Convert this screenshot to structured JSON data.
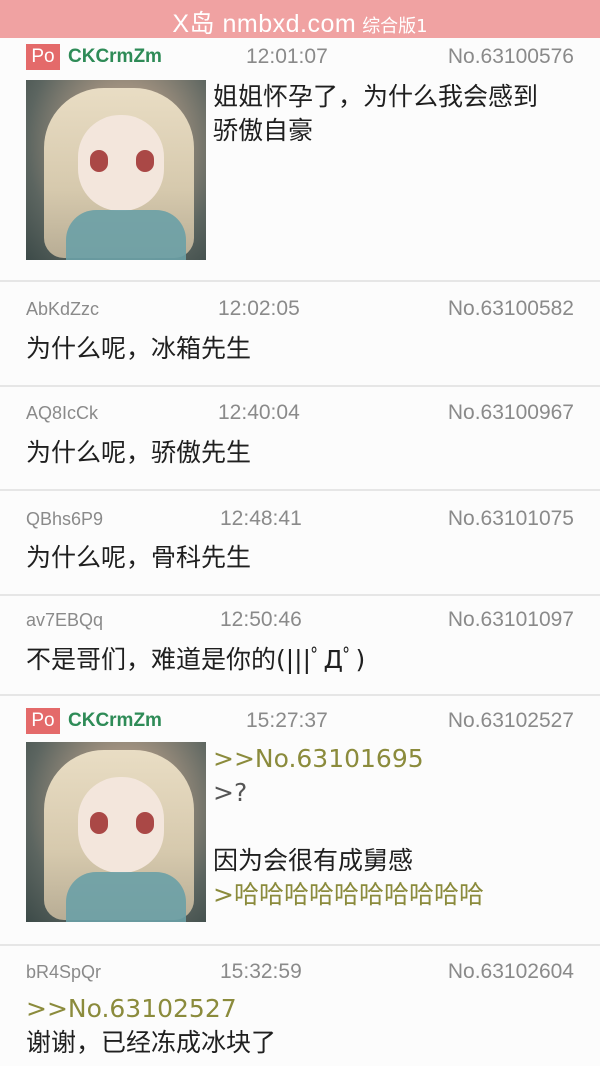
{
  "header": {
    "title": "X岛 nmbxd.com",
    "subtitle": "综合版1"
  },
  "colors": {
    "header_bg": "#f0a2a2",
    "po_badge": "#e46a6a",
    "po_uid": "#2e8b57",
    "quote": "#8b8b3c"
  },
  "posts": [
    {
      "po": true,
      "po_label": "Po",
      "uid": "CKCrmZm",
      "time": "12:01:07",
      "no": "No.63100576",
      "lines": [
        "姐姐怀孕了，为什么我会感到",
        "骄傲自豪"
      ]
    },
    {
      "po": false,
      "uid": "AbKdZzc",
      "time": "12:02:05",
      "no": "No.63100582",
      "lines": [
        "为什么呢，冰箱先生"
      ]
    },
    {
      "po": false,
      "uid": "AQ8IcCk",
      "time": "12:40:04",
      "no": "No.63100967",
      "lines": [
        "为什么呢，骄傲先生"
      ]
    },
    {
      "po": false,
      "uid": "QBhs6P9",
      "time": "12:48:41",
      "no": "No.63101075",
      "lines": [
        "为什么呢，骨科先生"
      ]
    },
    {
      "po": false,
      "uid": "av7EBQq",
      "time": "12:50:46",
      "no": "No.63101097",
      "lines": [
        "不是哥们，难道是你的(|||ﾟДﾟ)"
      ]
    },
    {
      "po": true,
      "po_label": "Po",
      "uid": "CKCrmZm",
      "time": "15:27:37",
      "no": "No.63102527",
      "quote": ">>No.63101695",
      "greentext1": ">?",
      "line": "因为会很有成舅感",
      "greentext2": ">哈哈哈哈哈哈哈哈哈哈"
    },
    {
      "po": false,
      "uid": "bR4SpQr",
      "time": "15:32:59",
      "no": "No.63102604",
      "quote": ">>No.63102527",
      "line": "谢谢，已经冻成冰块了"
    }
  ]
}
